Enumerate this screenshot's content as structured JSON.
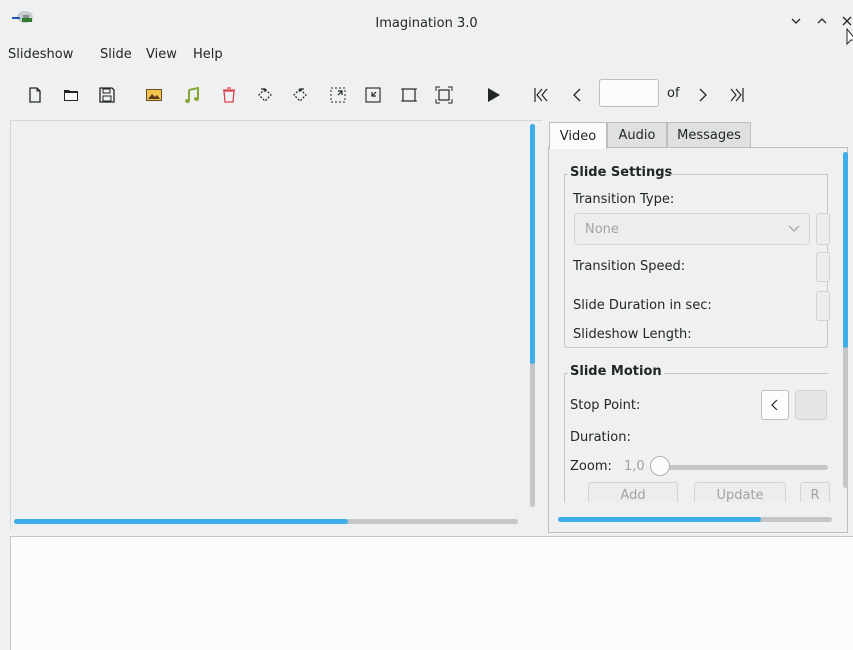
{
  "window": {
    "title": "Imagination 3.0"
  },
  "menu": {
    "items": [
      "Slideshow",
      "Slide",
      "View",
      "Help"
    ]
  },
  "toolbar": {
    "of_label": "of",
    "slide_number": ""
  },
  "tabs": [
    "Video",
    "Audio",
    "Messages"
  ],
  "slide_settings": {
    "title": "Slide Settings",
    "transition_type_label": "Transition Type:",
    "transition_type_value": "None",
    "transition_speed_label": "Transition Speed:",
    "slide_duration_label": "Slide Duration in sec:",
    "slideshow_length_label": "Slideshow Length:"
  },
  "slide_motion": {
    "title": "Slide Motion",
    "stop_point_label": "Stop Point:",
    "duration_label": "Duration:",
    "zoom_label": "Zoom:",
    "zoom_value": "1,0",
    "add_label": "Add",
    "update_label": "Update",
    "third_label": "R"
  },
  "colors": {
    "accent": "#3daee9",
    "background": "#eff0f1",
    "text": "#232627"
  }
}
